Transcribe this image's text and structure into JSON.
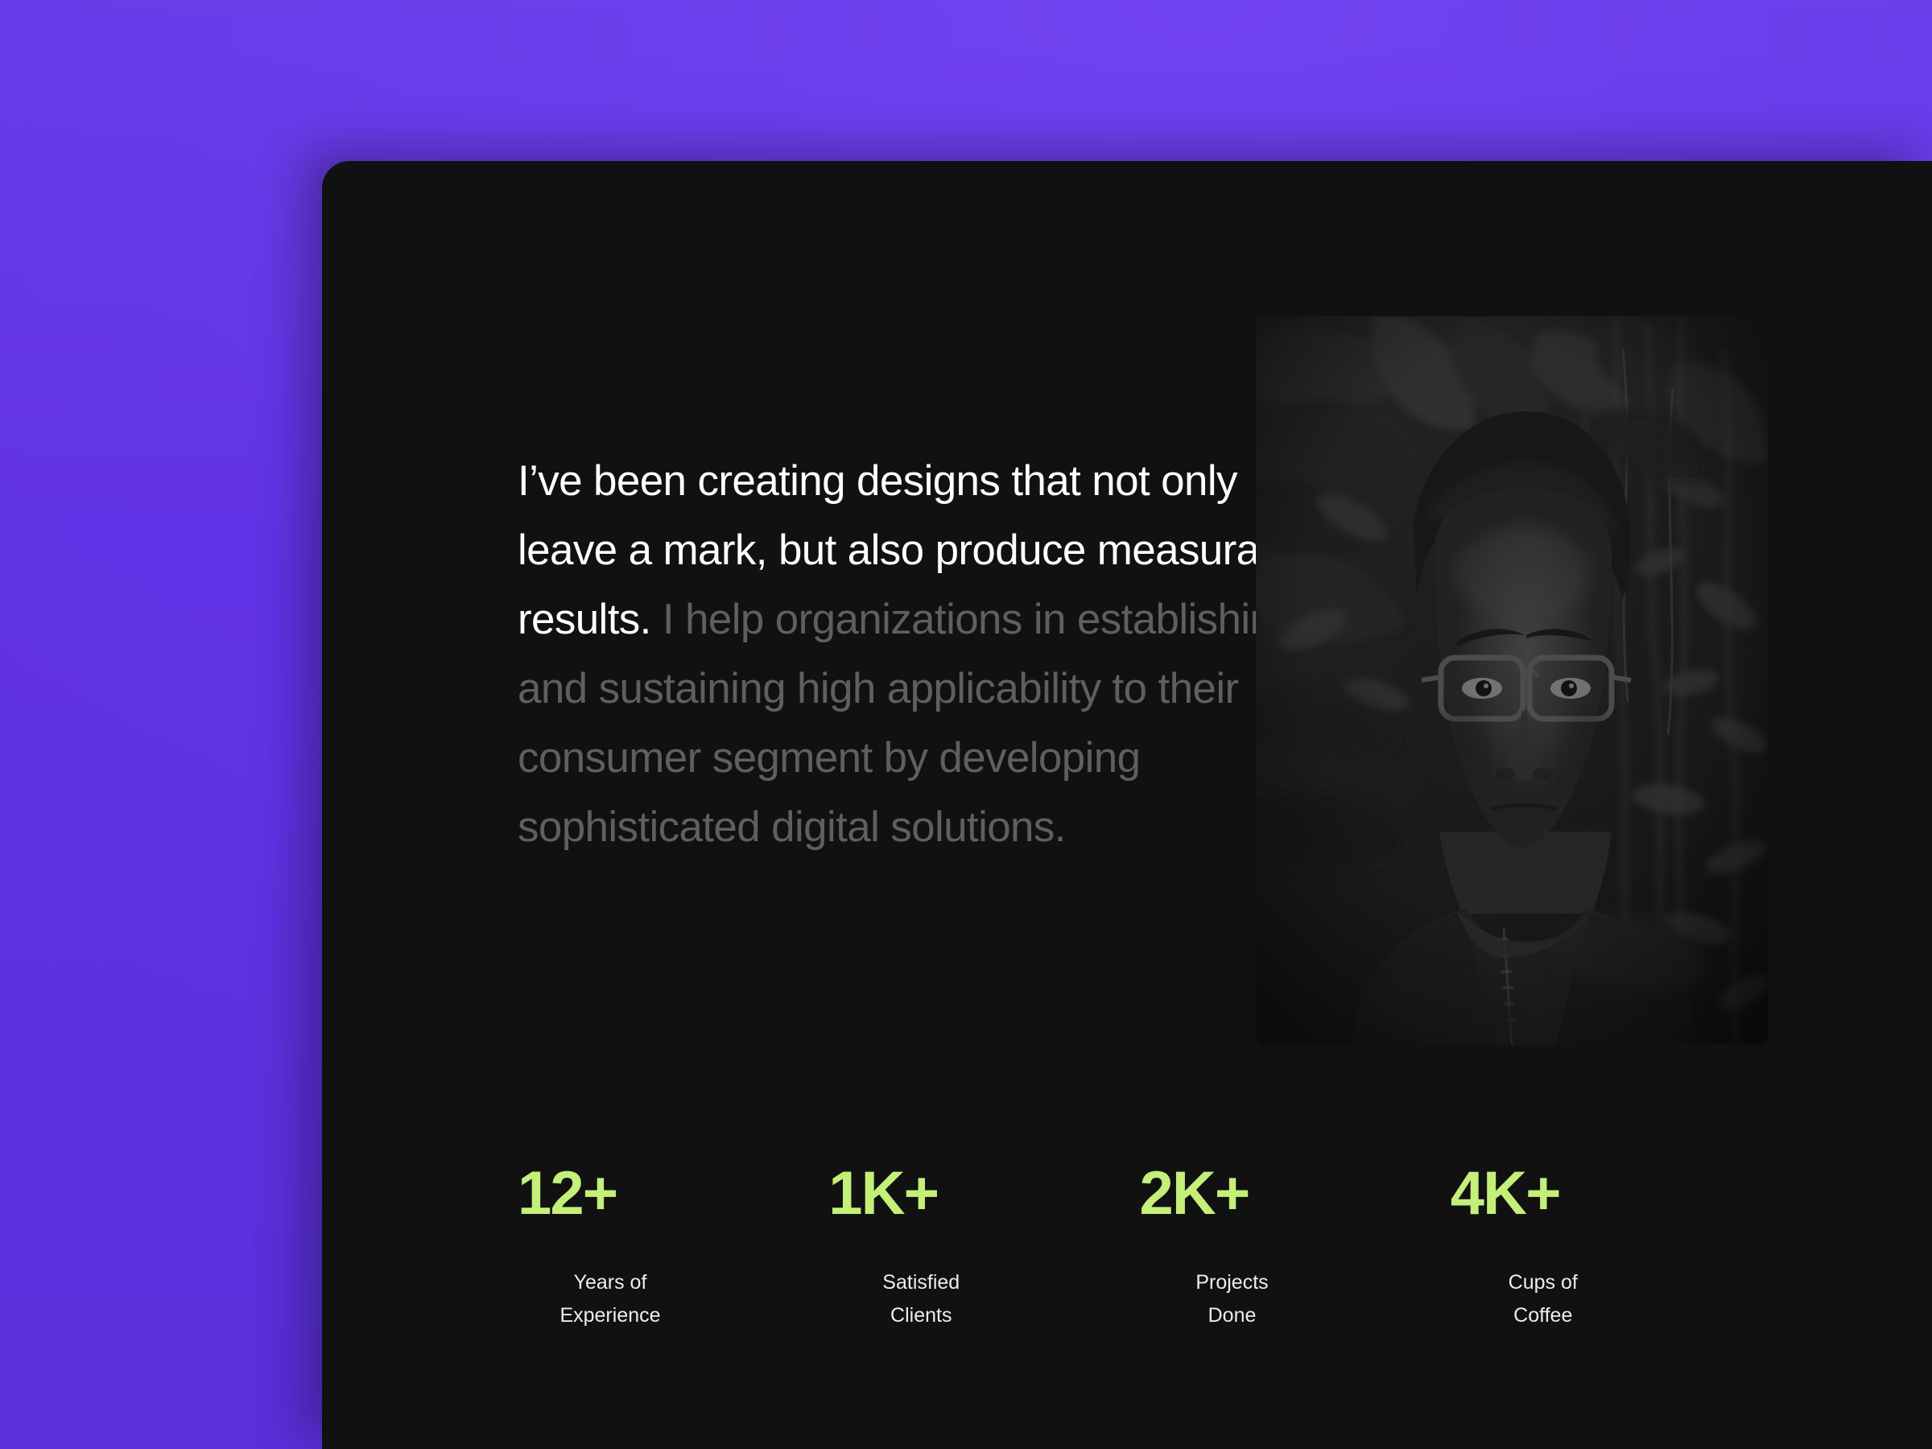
{
  "theme": {
    "backdrop_purple": "#6234E7",
    "card_background": "#111111",
    "accent_green": "#C4EF79",
    "headline_color": "#FFFFFF",
    "muted_text_color": "#5F5F5F"
  },
  "about": {
    "headline_highlight": "I’ve been creating designs that not only leave a mark, but also produce measurable results.",
    "headline_rest": " I help organizations in establishing and sustaining high applicability to their consumer segment by developing sophisticated digital solutions."
  },
  "portrait": {
    "alt": "portrait-photo-man-with-glasses-among-foliage"
  },
  "stats": [
    {
      "value": "12+",
      "label_line1": "Years of",
      "label_line2": "Experience"
    },
    {
      "value": "1K+",
      "label_line1": "Satisfied",
      "label_line2": "Clients"
    },
    {
      "value": "2K+",
      "label_line1": "Projects",
      "label_line2": "Done"
    },
    {
      "value": "4K+",
      "label_line1": "Cups of",
      "label_line2": "Coffee"
    }
  ]
}
